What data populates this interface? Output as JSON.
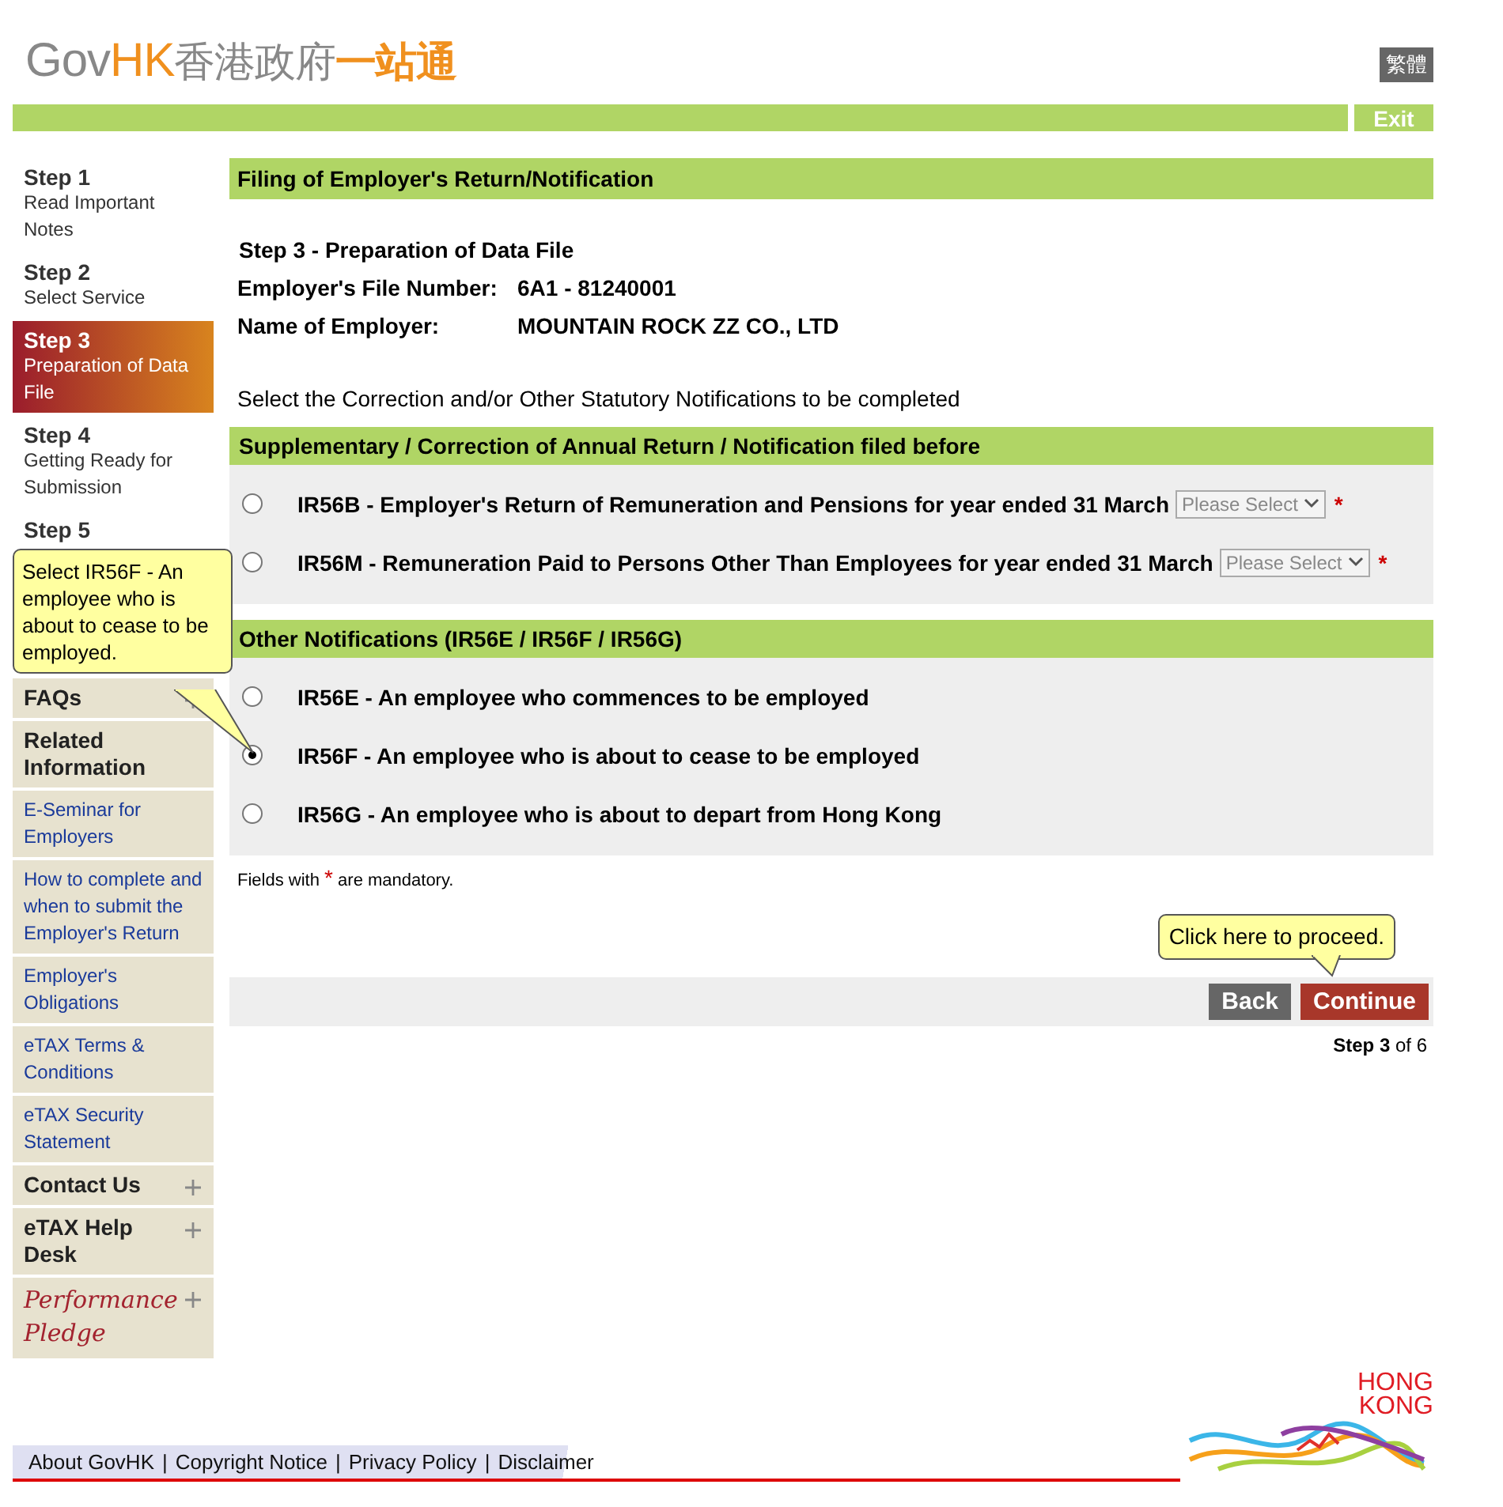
{
  "header": {
    "logo_latin": [
      "Gov",
      "HK"
    ],
    "logo_chinese": [
      "香港政府",
      "一站通"
    ],
    "language_button": "繁體",
    "exit_button": "Exit"
  },
  "steps": [
    {
      "step": "Step 1",
      "description": "Read Important Notes",
      "selected": false
    },
    {
      "step": "Step 2",
      "description": "Select Service",
      "selected": false
    },
    {
      "step": "Step 3",
      "description": "Preparation of Data File",
      "selected": true
    },
    {
      "step": "Step 4",
      "description": "Getting Ready for Submission",
      "selected": false
    },
    {
      "step": "Step 5",
      "selected": false
    }
  ],
  "sidebar_links": [
    {
      "kind": "heading",
      "label": "FAQs",
      "expandable": true
    },
    {
      "kind": "heading",
      "label": "Related Information",
      "expandable": false
    },
    {
      "kind": "link",
      "label": "E-Seminar for Employers"
    },
    {
      "kind": "link",
      "label": "How to complete and when to submit the Employer's Return"
    },
    {
      "kind": "link",
      "label": "Employer's Obligations"
    },
    {
      "kind": "link",
      "label": "eTAX Terms & Conditions"
    },
    {
      "kind": "link",
      "label": "eTAX Security Statement"
    },
    {
      "kind": "heading",
      "label": "Contact Us",
      "expandable": true
    },
    {
      "kind": "heading",
      "label": "eTAX Help Desk",
      "expandable": true
    },
    {
      "kind": "pledge",
      "label": "Performance Pledge",
      "expandable": true
    }
  ],
  "callout_select": "Select IR56F - An employee who is about to cease to be employed.",
  "main": {
    "title": "Filing of Employer's Return/Notification",
    "step_heading": "Step 3 - Preparation of Data File",
    "fields": [
      {
        "label": "Employer's File Number:",
        "value": "6A1 - 81240001"
      },
      {
        "label": "Name of Employer:",
        "value": "MOUNTAIN ROCK ZZ CO., LTD"
      }
    ],
    "instruction": "Select the Correction and/or Other Statutory Notifications to be completed",
    "sections": [
      {
        "heading": "Supplementary / Correction of Annual Return / Notification filed before",
        "options": [
          {
            "label": "IR56B - Employer's Return of Remuneration and Pensions for year ended 31 March",
            "selected": false,
            "select_placeholder": "Please Select",
            "required_mark": "*"
          },
          {
            "label": "IR56M - Remuneration Paid to Persons Other Than Employees for year ended 31 March",
            "selected": false,
            "select_placeholder": "Please Select",
            "required_mark": "*"
          }
        ]
      },
      {
        "heading": "Other Notifications (IR56E / IR56F / IR56G)",
        "options": [
          {
            "label": "IR56E - An employee who commences to be employed",
            "selected": false
          },
          {
            "label": "IR56F - An employee who is about to cease to be employed",
            "selected": true
          },
          {
            "label": "IR56G - An employee who is about to depart from Hong Kong",
            "selected": false
          }
        ]
      }
    ],
    "mandatory_note": {
      "before": "Fields with",
      "mark": "*",
      "after": "are mandatory."
    },
    "callout_proceed": "Click here to proceed.",
    "buttons": [
      {
        "kind": "back",
        "label": "Back"
      },
      {
        "kind": "continue",
        "label": "Continue"
      }
    ],
    "step_counter": "**Step 3** of 6"
  },
  "footer": {
    "links": [
      "About GovHK",
      "Copyright Notice",
      "Privacy Policy",
      "Disclaimer"
    ],
    "separator": "|",
    "brand": [
      "HONG",
      "KONG"
    ]
  }
}
